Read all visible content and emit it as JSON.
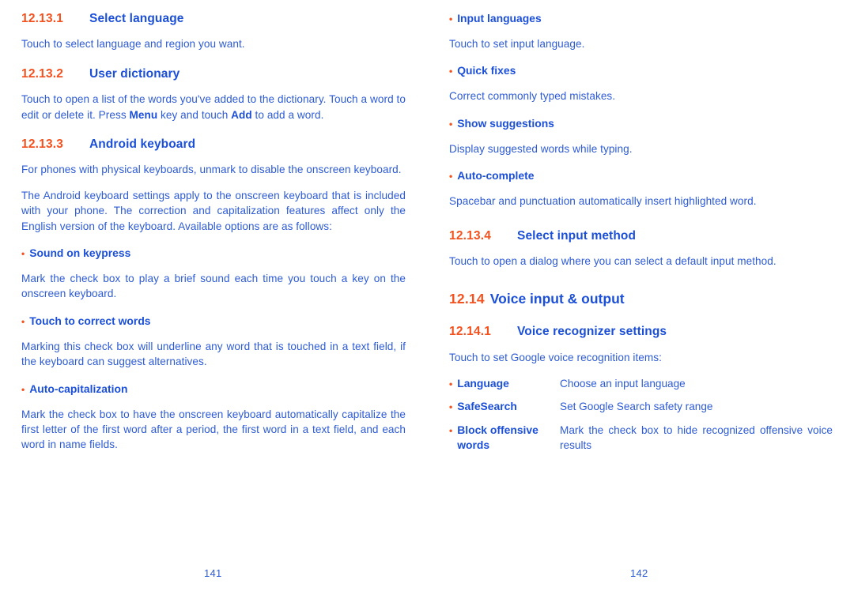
{
  "colors": {
    "accent_orange": "#F4511E",
    "heading_blue": "#1B4FD8",
    "body_blue": "#2D5BD6",
    "page_background": "#FFFFFF"
  },
  "left_page": {
    "folio": "141",
    "sections": {
      "select_language": {
        "number": "12.13.1",
        "title": "Select language",
        "body": "Touch to select language and region you want."
      },
      "user_dictionary": {
        "number": "12.13.2",
        "title": "User dictionary",
        "body_part1": "Touch to open a list of the words you've added to the dictionary. Touch a word to edit or delete it. Press ",
        "body_bold1": "Menu",
        "body_part2": " key and touch ",
        "body_bold2": "Add",
        "body_part3": " to add a word."
      },
      "android_keyboard": {
        "number": "12.13.3",
        "title": "Android keyboard",
        "body1": "For phones with physical keyboards, unmark to disable the onscreen keyboard.",
        "body2": "The Android keyboard settings apply to the onscreen keyboard that is included with your phone. The correction and capitalization features affect only the English version of the keyboard. Available options are as follows:",
        "bullets": [
          {
            "label": "Sound on keypress",
            "body": "Mark the check box to play a brief sound each time you touch a key on the onscreen keyboard."
          },
          {
            "label": "Touch to correct words",
            "body": "Marking this check box will underline any word that is touched in a text field, if the keyboard can suggest alternatives."
          },
          {
            "label": "Auto-capitalization",
            "body": "Mark the check box to have the onscreen keyboard automatically capitalize the first letter of the first word after a period, the first word in a text field, and each word in name fields."
          }
        ]
      }
    }
  },
  "right_page": {
    "folio": "142",
    "keyboard_bullets": [
      {
        "label": "Input languages",
        "body": "Touch to set input language."
      },
      {
        "label": "Quick fixes",
        "body": "Correct commonly typed mistakes."
      },
      {
        "label": "Show suggestions",
        "body": "Display suggested words while typing."
      },
      {
        "label": "Auto-complete",
        "body": "Spacebar and punctuation automatically insert highlighted word."
      }
    ],
    "select_input_method": {
      "number": "12.13.4",
      "title": "Select input method",
      "body": "Touch to open a dialog where you can select a default input method."
    },
    "voice_input_output": {
      "number": "12.14",
      "title": "Voice input & output"
    },
    "voice_recognizer_settings": {
      "number": "12.14.1",
      "title": "Voice recognizer settings",
      "body": "Touch to set Google voice recognition items:",
      "items": [
        {
          "label": "Language",
          "description": "Choose an input language"
        },
        {
          "label": "SafeSearch",
          "description": "Set Google Search safety range"
        },
        {
          "label": "Block offensive words",
          "description": "Mark the check box to hide recognized offensive voice results"
        }
      ]
    }
  },
  "symbols": {
    "bullet": "•"
  }
}
